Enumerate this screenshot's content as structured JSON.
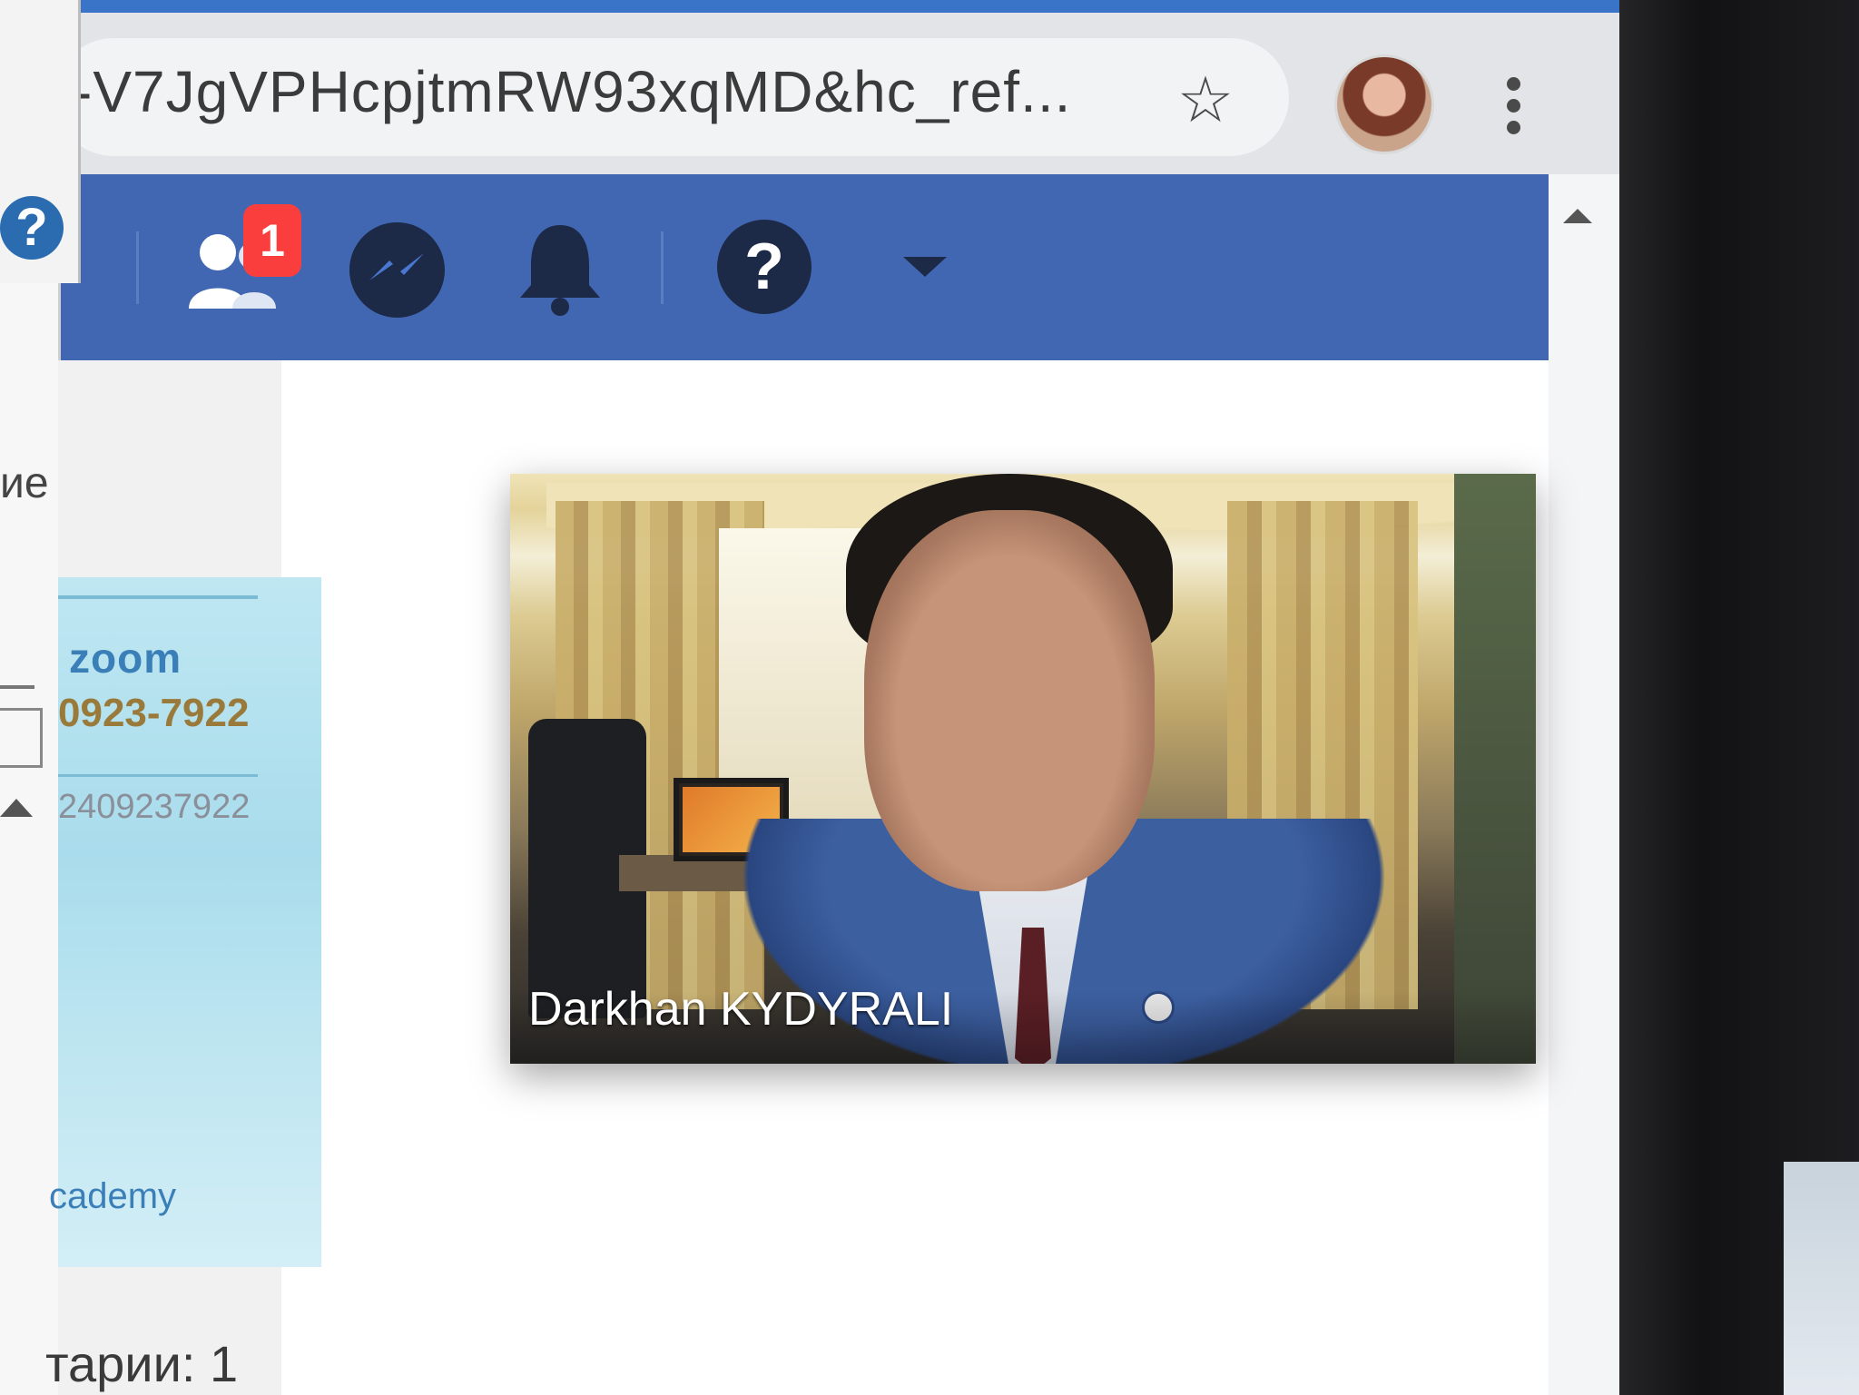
{
  "browser": {
    "url_text": "-V7JgVPHcpjtmRW93xqMD&hc_ref...",
    "icons": [
      "star-icon",
      "profile-avatar",
      "more-vert-icon"
    ]
  },
  "fb_header": {
    "friend_requests_badge": "1",
    "icons": [
      "friends-icon",
      "messenger-icon",
      "bell-icon",
      "help-icon",
      "dropdown-icon"
    ]
  },
  "left_panel": {
    "partial_label": "ие",
    "icons": [
      "help-icon",
      "scroll-up-icon"
    ]
  },
  "zoom_card": {
    "logo": "zoom",
    "phone": "0923-7922",
    "meeting_id": "2409237922",
    "footer_text": "cademy"
  },
  "comments": {
    "label": "тарии: 1"
  },
  "video": {
    "participant_name": "Darkhan KYDYRALI"
  },
  "colors": {
    "fb_blue": "#4267b2",
    "badge_red": "#fa3e3e"
  }
}
